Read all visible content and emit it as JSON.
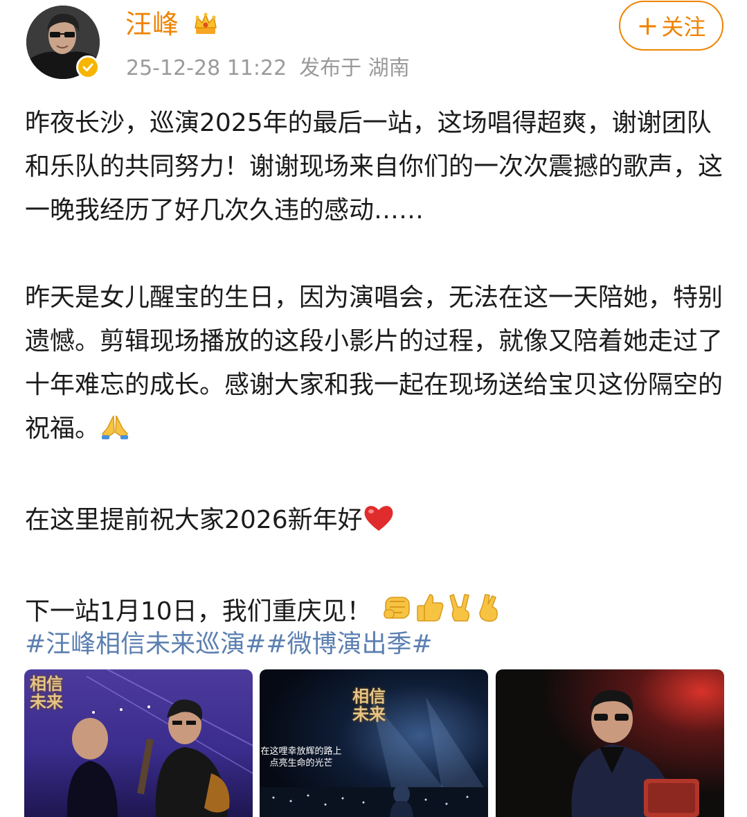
{
  "post": {
    "author": {
      "name": "汪峰",
      "avatar_alt": "avatar",
      "badge": "crown-icon",
      "verified": "verified-icon"
    },
    "meta": {
      "date": "25-12-28 11:22",
      "location": "发布于 湖南"
    },
    "follow_button": {
      "plus": "+",
      "label": "关注"
    },
    "paragraphs": [
      "昨夜长沙，巡演2025年的最后一站，这场唱得超爽，谢谢团队和乐队的共同努力！谢谢现场来自你们的一次次震撼的歌声，这一晚我经历了好几次久违的感动……",
      "昨天是女儿醒宝的生日，因为演唱会，无法在这一天陪她，特别遗憾。剪辑现场播放的这段小影片的过程，就像又陪着她走过了十年难忘的成长。感谢大家和我一起在现场送给宝贝这份隔空的祝福。",
      "在这里提前祝大家2026新年好",
      "下一站1月10日，我们重庆见！"
    ],
    "emojis": {
      "pray": "pray-emoji",
      "heart": "red-heart-emoji",
      "fist": "fist-emoji",
      "thumbs": "thumbs-up-emoji",
      "victory": "victory-emoji",
      "crossed": "crossed-fingers-emoji"
    },
    "hashtags": [
      "#汪峰相信未来巡演#",
      "#微博演出季#"
    ],
    "photos": [
      {
        "title": "相信未来",
        "caption": ""
      },
      {
        "title": "相信未来",
        "caption": "在这哩幸放辉的路上 点亮生命的光芒"
      },
      {
        "title": "",
        "caption": ""
      }
    ]
  },
  "colors": {
    "brand_orange": "#f08300",
    "hashtag_blue": "#5b7fb0",
    "meta_gray": "#9a9a9a",
    "text": "#1b1b1b"
  }
}
